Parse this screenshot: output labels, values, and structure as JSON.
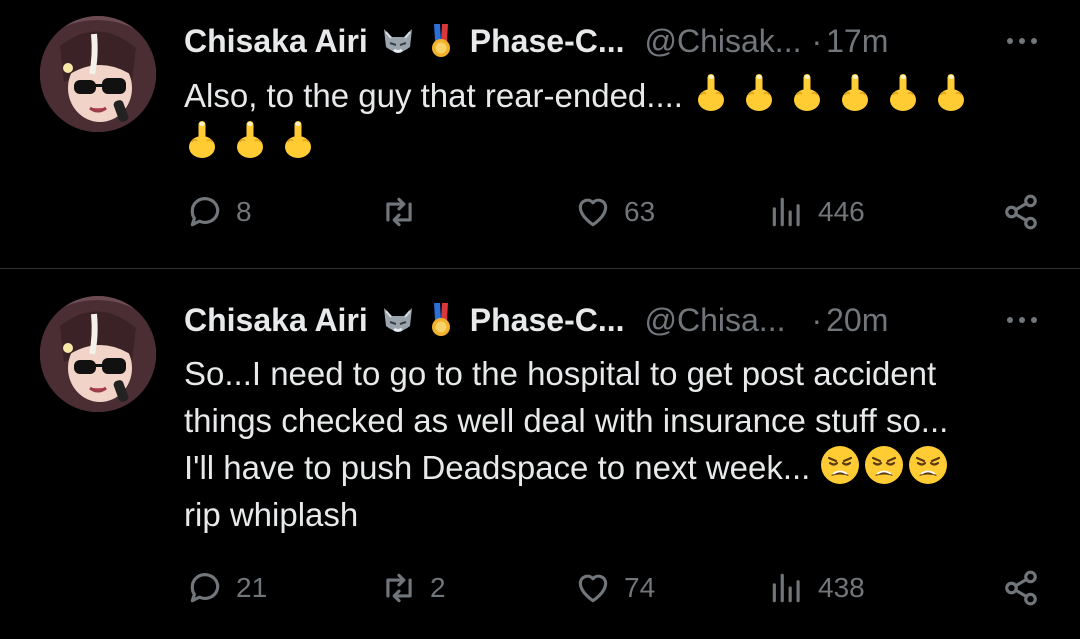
{
  "tweets": [
    {
      "author": {
        "name": "Chisaka Airi",
        "badges": [
          "wolf-emoji",
          "medal-emoji"
        ],
        "community": "Phase-C...",
        "handle": "@Chisak..."
      },
      "dot": "·",
      "time": "17m",
      "text": "Also, to the guy that rear-ended....",
      "emoji": [
        "middle-finger",
        "middle-finger",
        "middle-finger",
        "middle-finger",
        "middle-finger",
        "middle-finger",
        "middle-finger",
        "middle-finger",
        "middle-finger"
      ],
      "stats": {
        "replies": "8",
        "reposts": "",
        "likes": "63",
        "views": "446"
      }
    },
    {
      "author": {
        "name": "Chisaka Airi",
        "badges": [
          "wolf-emoji",
          "medal-emoji"
        ],
        "community": "Phase-C...",
        "handle": "@Chisa..."
      },
      "dot": "·",
      "time": "20m",
      "text_line1": "So...I need to go to the hospital to get post accident",
      "text_line2": "things checked as well deal with insurance stuff so...",
      "text_line3": "I'll have to push Deadspace to next week...",
      "text_line4": "rip whiplash",
      "emoji": [
        "weary-face",
        "weary-face",
        "weary-face"
      ],
      "stats": {
        "replies": "21",
        "reposts": "2",
        "likes": "74",
        "views": "438"
      }
    }
  ],
  "colors": {
    "background": "#000000",
    "text": "#e7e9ea",
    "muted": "#71767b",
    "divider": "#2f3336",
    "emoji_yellow": "#ffcc33"
  }
}
